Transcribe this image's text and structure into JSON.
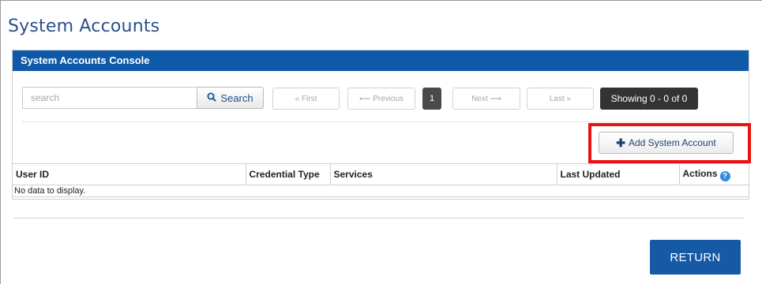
{
  "page": {
    "title": "System Accounts"
  },
  "console": {
    "header": "System Accounts Console",
    "search": {
      "placeholder": "search",
      "value": "",
      "button_label": "Search",
      "icon": "search-icon"
    },
    "pagination": {
      "first": "« First",
      "previous": "⟵ Previous",
      "current_page": "1",
      "next": "Next ⟶",
      "last": "Last »",
      "showing": "Showing 0 - 0 of 0"
    },
    "add_button": {
      "label": "Add System Account",
      "icon": "plus-icon",
      "highlight_color": "#ea1111"
    },
    "table": {
      "columns": [
        "User ID",
        "Credential Type",
        "Services",
        "Last Updated",
        "Actions"
      ],
      "empty_message": "No data to display.",
      "actions_help_icon": "question-circle-icon"
    }
  },
  "footer": {
    "return_label": "RETURN"
  },
  "colors": {
    "brand": "#0f5aa8",
    "title": "#2b4f8c",
    "return_button": "#165aa6",
    "help_icon": "#2f8ae0"
  }
}
